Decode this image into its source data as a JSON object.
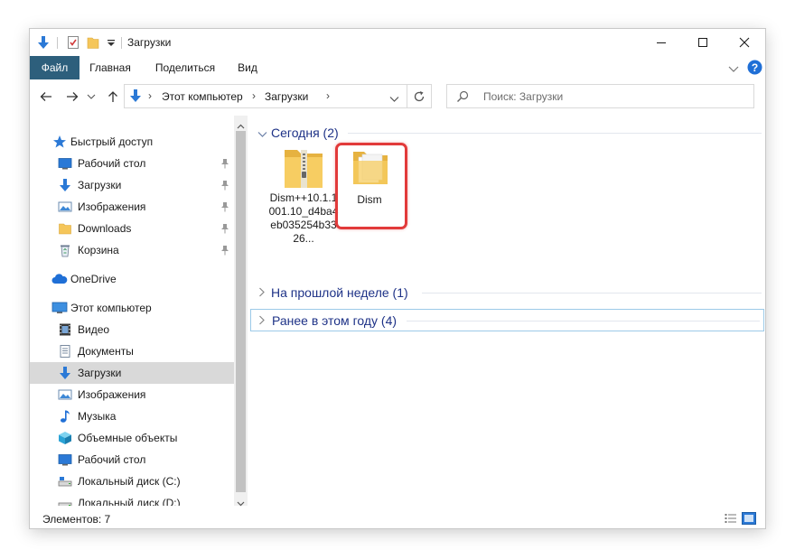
{
  "window": {
    "title": "Загрузки"
  },
  "ribbon": {
    "tabs": [
      {
        "label": "Файл",
        "active": true
      },
      {
        "label": "Главная"
      },
      {
        "label": "Поделиться"
      },
      {
        "label": "Вид"
      }
    ]
  },
  "address": {
    "path": [
      "Этот компьютер",
      "Загрузки"
    ]
  },
  "search": {
    "placeholder": "Поиск: Загрузки"
  },
  "nav": {
    "items": [
      {
        "label": "Быстрый доступ",
        "icon": "star-icon"
      },
      {
        "label": "Рабочий стол",
        "icon": "desktop-icon",
        "pinned": true
      },
      {
        "label": "Загрузки",
        "icon": "download-arrow-icon",
        "pinned": true
      },
      {
        "label": "Изображения",
        "icon": "pictures-icon",
        "pinned": true
      },
      {
        "label": "Downloads",
        "icon": "folder-icon",
        "pinned": true
      },
      {
        "label": "Корзина",
        "icon": "recycle-bin-icon",
        "pinned": true
      },
      {
        "label": "OneDrive",
        "icon": "cloud-icon"
      },
      {
        "label": "Этот компьютер",
        "icon": "computer-icon"
      },
      {
        "label": "Видео",
        "icon": "video-icon"
      },
      {
        "label": "Документы",
        "icon": "documents-icon"
      },
      {
        "label": "Загрузки",
        "icon": "download-arrow-icon",
        "selected": true
      },
      {
        "label": "Изображения",
        "icon": "pictures-icon"
      },
      {
        "label": "Музыка",
        "icon": "music-icon"
      },
      {
        "label": "Объемные объекты",
        "icon": "3d-objects-icon"
      },
      {
        "label": "Рабочий стол",
        "icon": "desktop-icon"
      },
      {
        "label": "Локальный диск (C:)",
        "icon": "drive-c-icon"
      },
      {
        "label": "Локальный диск (D:)",
        "icon": "drive-d-icon"
      }
    ]
  },
  "content": {
    "groups": [
      {
        "label": "Сегодня (2)",
        "expanded": true
      },
      {
        "label": "На прошлой неделе (1)",
        "expanded": false
      },
      {
        "label": "Ранее в этом году (4)",
        "expanded": false
      }
    ],
    "files": [
      {
        "label": "Dism++10.1.1001.10_d4ba4eb035254b3326...",
        "icon": "zip-folder-icon"
      },
      {
        "label": "Dism",
        "icon": "folder-icon",
        "highlighted": true
      }
    ]
  },
  "status": {
    "items_text": "Элементов: 7"
  },
  "colors": {
    "file_tab": "#2d5f7c",
    "group_header": "#1e3287",
    "highlight": "#e23a3a",
    "selection": "#d9d9d9",
    "folder": "#f5c65a",
    "download_blue": "#2b79d6"
  }
}
